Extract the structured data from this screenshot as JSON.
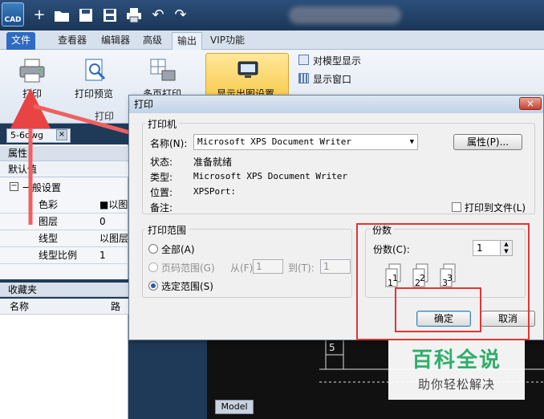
{
  "app": {
    "logo_text": "CAD"
  },
  "quick_access": [
    "+",
    "▬",
    "◼",
    "◼",
    "⎙",
    "↶",
    "↷"
  ],
  "ribbon": {
    "tabs": [
      {
        "label": "文件",
        "style": "file"
      },
      {
        "label": "查看器",
        "style": "normal"
      },
      {
        "label": "编辑器",
        "style": "normal"
      },
      {
        "label": "高级",
        "style": "normal"
      },
      {
        "label": "输出",
        "style": "active"
      },
      {
        "label": "VIP功能",
        "style": "normal"
      }
    ],
    "print_label": "打印",
    "preview_label": "打印预览",
    "multi_label": "多页打印",
    "group_label": "打印",
    "active_label": "显示出图设置",
    "model_display": "对模型显示",
    "show_window": "显示窗口"
  },
  "doc_tab": {
    "label": "5-6dwg",
    "close": "×"
  },
  "properties": {
    "header": "属性",
    "default": "默认值",
    "section": "一般设置",
    "rows": [
      {
        "key": "色彩",
        "value": "■以图"
      },
      {
        "key": "图层",
        "value": "0"
      },
      {
        "key": "线型",
        "value": "以图层"
      },
      {
        "key": "线型比例",
        "value": "1"
      }
    ]
  },
  "favorites": {
    "header": "收藏夹",
    "col_name": "名称",
    "col_path": "路径"
  },
  "model_tab": "Model",
  "dialog": {
    "title": "打印",
    "close": "×",
    "printer": {
      "group": "打印机",
      "name_label": "名称(N):",
      "name_value": "Microsoft XPS Document Writer",
      "properties_btn": "属性(P)...",
      "status_label": "状态:",
      "status_value": "准备就绪",
      "type_label": "类型:",
      "type_value": "Microsoft XPS Document Writer",
      "where_label": "位置:",
      "where_value": "XPSPort:",
      "comment_label": "备注:",
      "print_to_file": "打印到文件(L)"
    },
    "range": {
      "group": "打印范围",
      "all": "全部(A)",
      "pages": "页码范围(G)",
      "from": "从(F):",
      "from_value": "1",
      "to": "到(T):",
      "to_value": "1",
      "selection": "选定范围(S)"
    },
    "copies": {
      "group": "份数",
      "label": "份数(C):",
      "value": "1"
    },
    "ok": "确定",
    "cancel": "取消"
  },
  "watermark": {
    "main": "百科全说",
    "sub": "助你轻松解决"
  }
}
